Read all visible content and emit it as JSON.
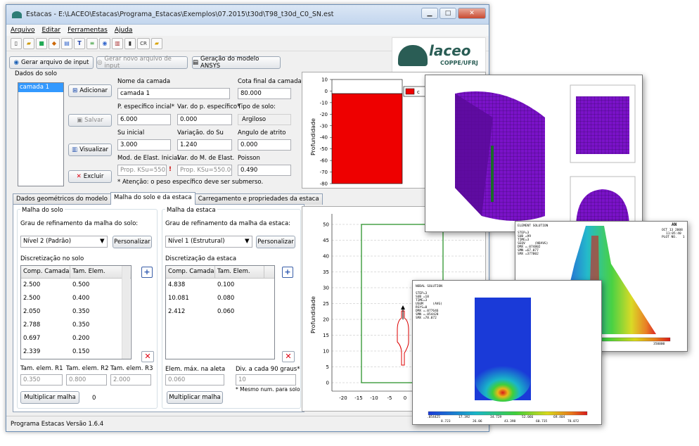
{
  "window": {
    "title": "Estacas - E:\\LACEO\\Estacas\\Programa_Estacas\\Exemplos\\07.2015\\t30d\\T98_t30d_C0_SN.est"
  },
  "menu": [
    "Arquivo",
    "Editar",
    "Ferramentas",
    "Ajuda"
  ],
  "toolbar_icons": [
    "new-file-icon",
    "open-file-icon",
    "save-icon",
    "soil-icon",
    "export-icon",
    "text-icon",
    "layers-icon",
    "view-icon",
    "chart-icon",
    "pile-icon",
    "cr-icon",
    "folder-icon"
  ],
  "toolbar_cr": "CR",
  "logo": {
    "name": "laceo",
    "sub": "COPPE/UFRJ"
  },
  "actions": {
    "gen_input": "Gerar arquivo de input",
    "gen_new_input": "Gerar novo arquivo de input",
    "gen_ansys": "Geração do modelo ANSYS"
  },
  "soil": {
    "section_title": "Dados do solo",
    "layers": [
      "camada 1"
    ],
    "add": "Adicionar",
    "save": "Salvar",
    "view": "Visualizar",
    "delete": "Excluir",
    "name_label": "Nome da camada",
    "name_value": "camada 1",
    "cota_label": "Cota final da camada",
    "cota_value": "80.000",
    "pesp_label": "P. específico incial*",
    "pesp_value": "6.000",
    "var_pesp_label": "Var. do p. específico*",
    "var_pesp_value": "0.000",
    "tipo_label": "Tipo de solo:",
    "tipo_value": "Argiloso",
    "su_label": "Su inicial",
    "su_value": "3.000",
    "var_su_label": "Variação. do Su",
    "var_su_value": "1.240",
    "atrito_label": "Angulo de atrito",
    "atrito_value": "0.000",
    "mod_label": "Mod. de Elast. Inicial",
    "mod_value": "Prop. KSu=550.0",
    "var_mod_label": "Var. do M. de Elast.",
    "var_mod_value": "Prop. KSu=550.000",
    "poisson_label": "Poisson",
    "poisson_value": "0.490",
    "warning_mark": "!",
    "note": "* Atenção: o peso específico deve ser submerso."
  },
  "tabs": [
    "Dados geométricos do modelo",
    "Malha do solo e da estaca",
    "Carregamento e propriedades da estaca"
  ],
  "malha_solo": {
    "title": "Malha do solo",
    "refine_label": "Grau de refinamento da malha do solo:",
    "refine_value": "Nível 2 (Padrão)",
    "personalize": "Personalizar",
    "disc_label": "Discretização no solo",
    "headers": [
      "Comp. Camada",
      "Tam. Elem."
    ],
    "rows": [
      [
        "2.500",
        "0.500"
      ],
      [
        "2.500",
        "0.400"
      ],
      [
        "2.050",
        "0.350"
      ],
      [
        "2.788",
        "0.350"
      ],
      [
        "0.697",
        "0.200"
      ],
      [
        "2.339",
        "0.150"
      ]
    ],
    "r1_label": "Tam. elem. R1",
    "r1_value": "0.350",
    "r2_label": "Tam. elem. R2",
    "r2_value": "0.800",
    "r3_label": "Tam. elem. R3",
    "r3_value": "2.000",
    "multiply": "Multiplicar malha",
    "multiply_count": "0"
  },
  "malha_estaca": {
    "title": "Malha da estaca",
    "refine_label": "Grau de refinamento da malha da estaca:",
    "refine_value": "Nível 1 (Estrutural)",
    "personalize": "Personalizar",
    "disc_label": "Discretização da estaca",
    "headers": [
      "Comp. Camada",
      "Tam. Elem."
    ],
    "rows": [
      [
        "4.838",
        "0.100"
      ],
      [
        "10.081",
        "0.080"
      ],
      [
        "2.412",
        "0.060"
      ]
    ],
    "elem_max_label": "Elem. máx. na aleta",
    "elem_max_value": "0.060",
    "div_label": "Div. a cada 90 graus*",
    "div_value": "10",
    "div_note": "* Mesmo num. para solo",
    "multiply": "Multiplicar malha"
  },
  "status": "Programa Estacas Versão 1.6.4",
  "plot_top": {
    "ylabel": "Profundidade",
    "yticks": [
      "10",
      "0",
      "-10",
      "-20",
      "-30",
      "-40",
      "-50",
      "-60",
      "-70",
      "-80"
    ],
    "legend": "c",
    "fill": "#ee0000"
  },
  "plot_bottom": {
    "ylabel": "Profundidade",
    "yticks": [
      "50",
      "45",
      "40",
      "35",
      "30",
      "25",
      "20",
      "15",
      "10",
      "5",
      "0"
    ],
    "xticks": [
      "-20",
      "-15",
      "-10",
      "-5",
      "0"
    ]
  },
  "overlay_sol": {
    "lines": [
      "NODAL SOLUTION",
      "",
      "STEP=3",
      "SUB =18",
      "TIME=3",
      "USUM     (AVG)",
      "RSYS=0",
      "DMX =.077646",
      "SMN =.054428",
      "SMX =78.072"
    ],
    "scale_top": [
      ".054425",
      "17.392",
      "34.729",
      "52.066",
      "69.404"
    ],
    "scale_bot": [
      "8.723",
      "26.06",
      "43.398",
      "60.735",
      "78.072"
    ]
  },
  "overlay_elem": {
    "lines": [
      "ELEMENT SOLUTION",
      "",
      "STEP=3",
      "SUB =99",
      "TIME=3",
      "SEQV     (NOAVG)",
      "DMX =.074802",
      "SMN =67.077",
      "SMX =377002"
    ],
    "tag": "AN",
    "date": "OCT 13 2008",
    "time": "11:05:40",
    "plot": "PLOT NO.   1",
    "scale_left": "36689",
    "scale_right": "350000",
    "foot": "T98 - Sem Melhoras"
  }
}
